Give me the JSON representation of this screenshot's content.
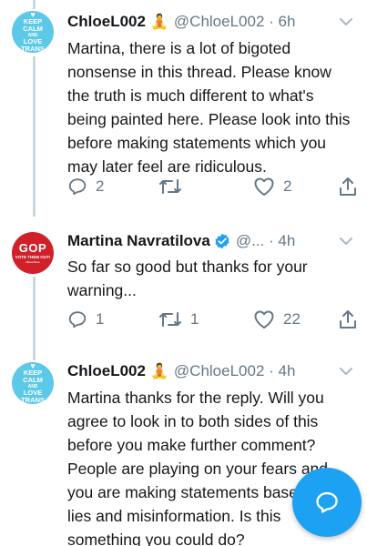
{
  "tweets": [
    {
      "display_name": "ChloeL002",
      "handle_time": "@ChloeL002 · 6h",
      "emoji": "🧘",
      "avatar": {
        "lines": [
          "KEEP",
          "CALM",
          "AND",
          "LOVE",
          "TRANS"
        ]
      },
      "body": "Martina, there is a lot of bigoted nonsense in this thread. Please know the truth is much different to what's being painted here. Please look into this before making statements which you may later feel are ridiculous.",
      "reply_count": "2",
      "retweet_count": "",
      "like_count": "2"
    },
    {
      "display_name": "Martina Navratilova",
      "handle_time": "@... · 4h",
      "verified": true,
      "avatar": {
        "big": "GOP",
        "sub": "VOTE THEM OUT!",
        "tiny": "#BlueWave"
      },
      "body": "So far so good but thanks for your warning...",
      "reply_count": "1",
      "retweet_count": "1",
      "like_count": "22"
    },
    {
      "display_name": "ChloeL002",
      "handle_time": "@ChloeL002 · 4h",
      "emoji": "🧘",
      "avatar": {
        "lines": [
          "KEEP",
          "CALM",
          "AND",
          "LOVE",
          "TRANS"
        ]
      },
      "body": "Martina thanks for the reply. Will you agree to look in to both sides of this before you make further comment? People are playing on your fears and you are making statements based on lies and misinformation. Is this something you could do?"
    }
  ],
  "icons": {
    "reply": "reply-icon",
    "retweet": "retweet-icon",
    "like": "heart-icon",
    "share": "share-icon",
    "compose": "compose-reply-icon"
  },
  "colors": {
    "accent": "#1da1f2",
    "muted": "#657786",
    "avatar_trans": "#5cc9e8",
    "avatar_gop": "#d0202a"
  }
}
